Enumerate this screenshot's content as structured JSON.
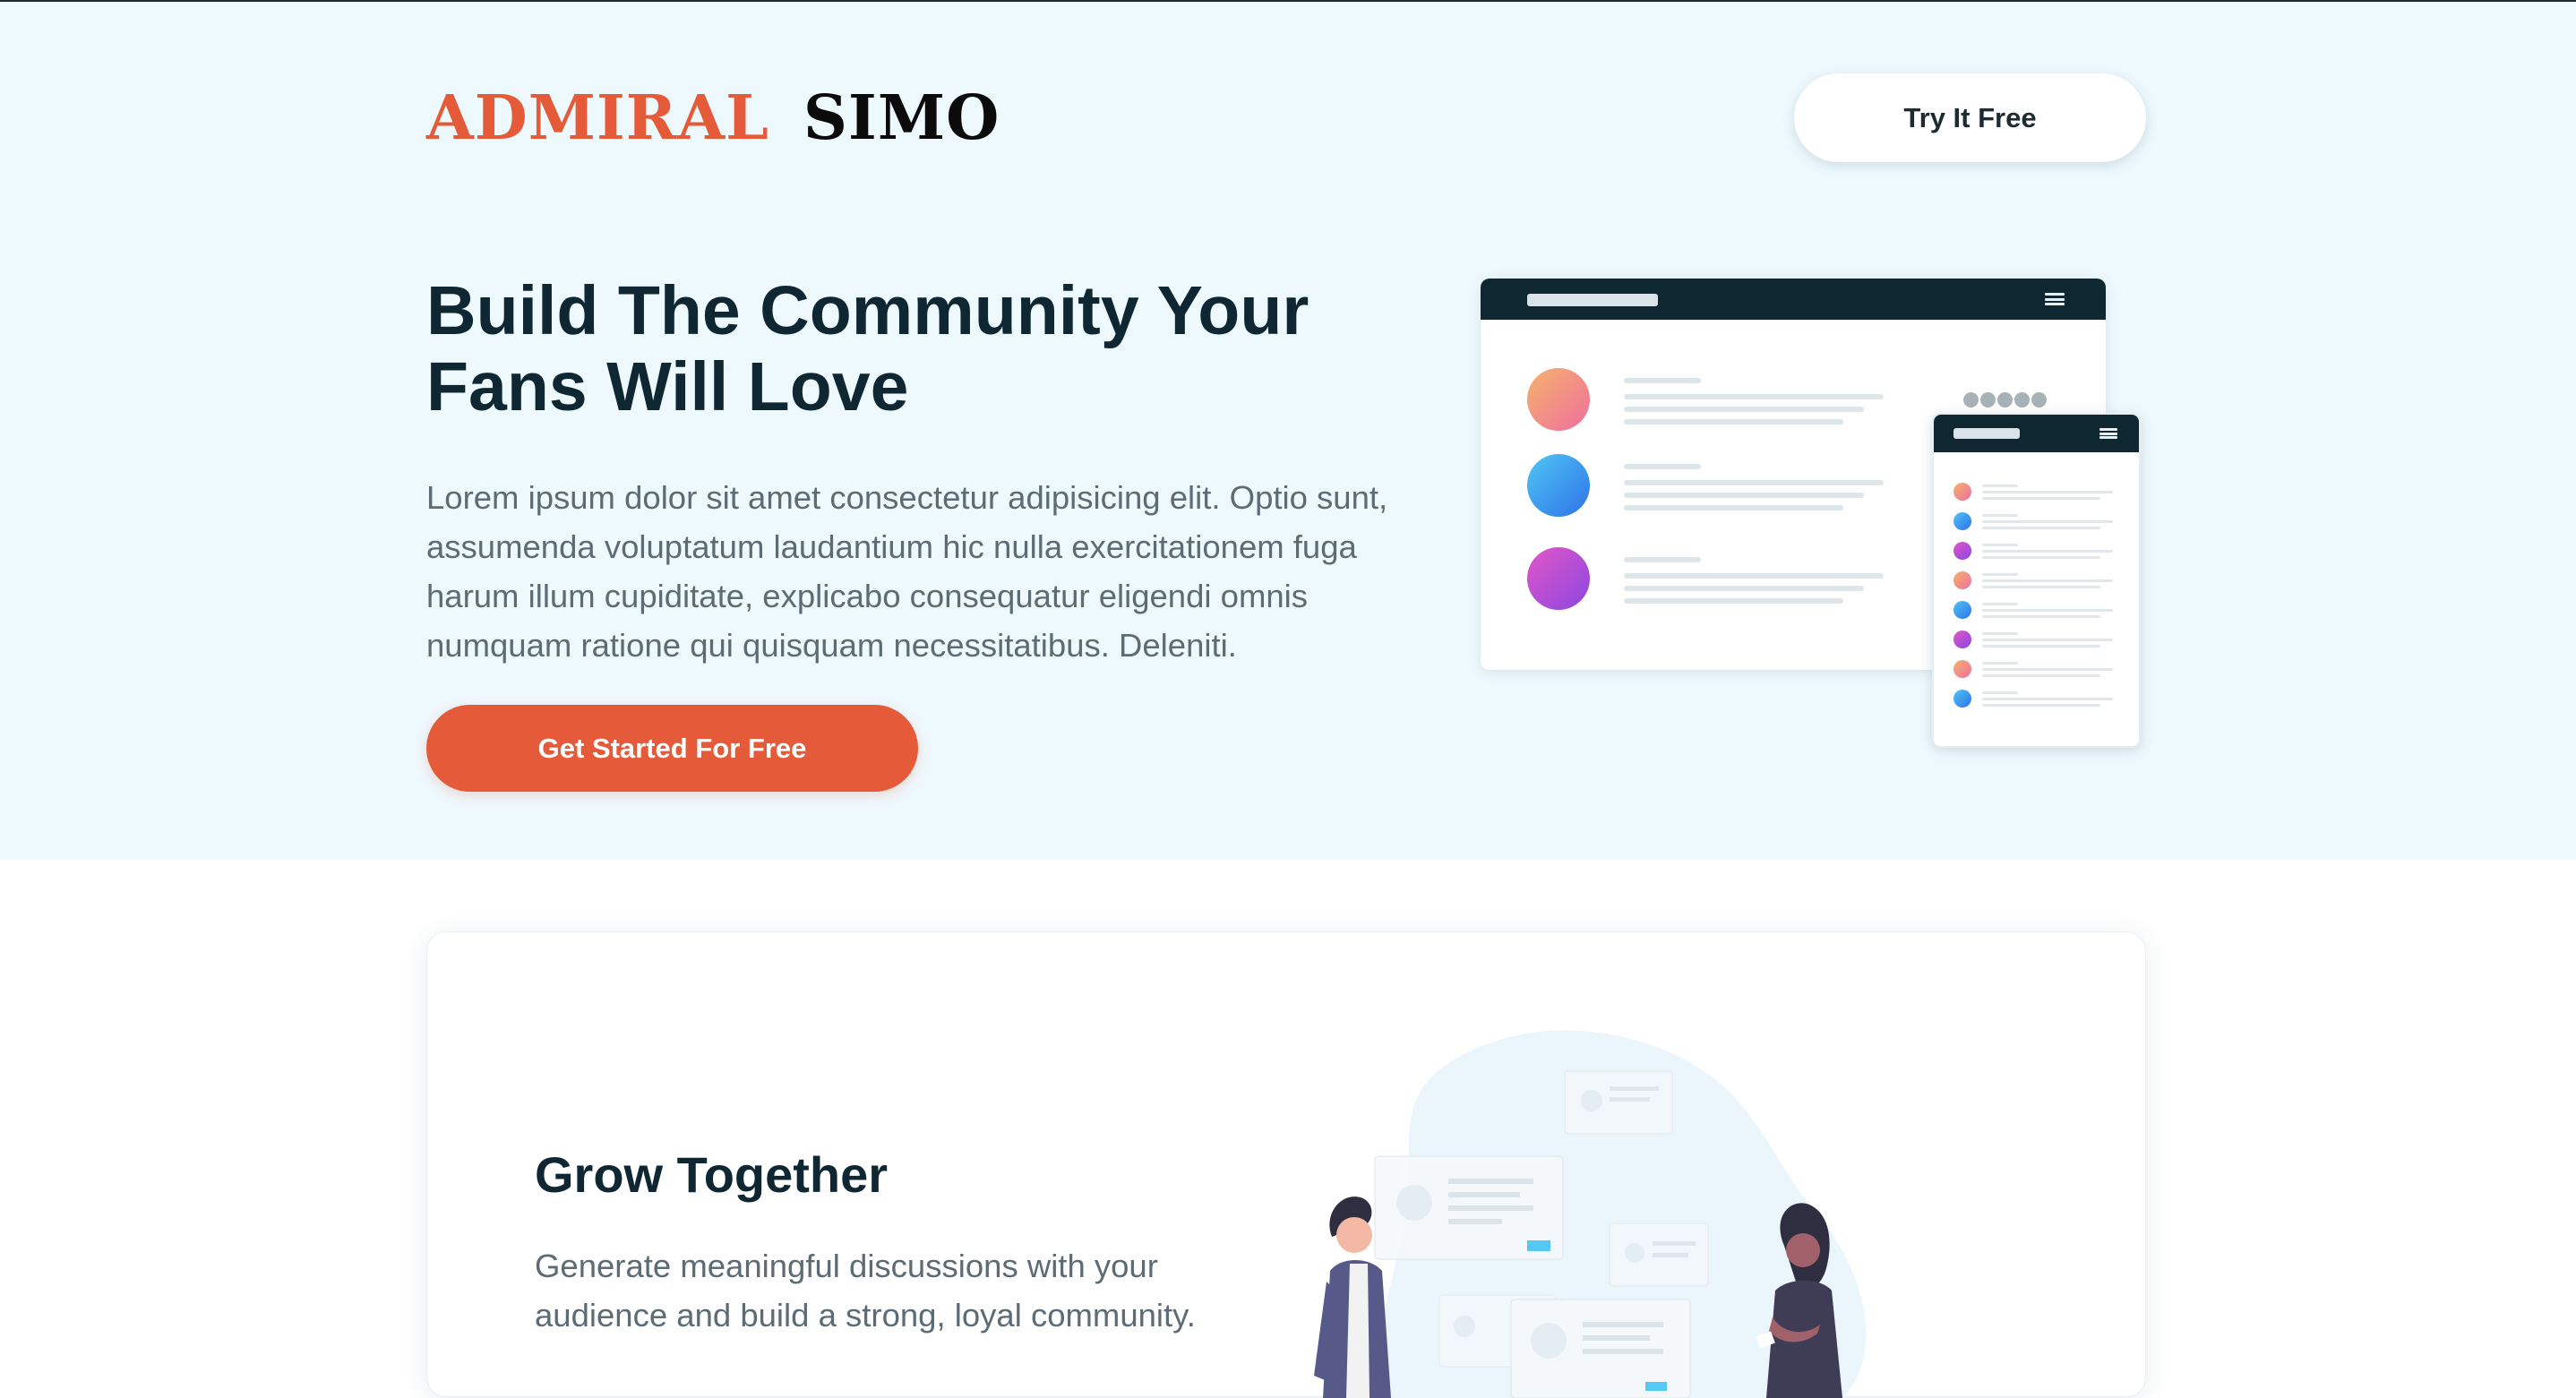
{
  "header": {
    "logo_word_1": "ADMIRAL",
    "logo_word_2": "SIMO",
    "try_button_label": "Try It Free"
  },
  "hero": {
    "title_line_1": "Build The Community Your",
    "title_line_2": "Fans Will Love",
    "paragraph": "Lorem ipsum dolor sit amet consectetur adipisicing elit. Optio sunt, assumenda voluptatum laudantium hic nulla exercitationem fuga harum illum cupiditate, explicabo consequatur eligendi omnis numquam ratione qui quisquam necessitatibus. Deleniti.",
    "cta_label": "Get Started For Free"
  },
  "features": {
    "title": "Grow Together",
    "paragraph": "Generate meaningful discussions with your audience and build a strong, loyal community."
  },
  "colors": {
    "brand_orange": "#e55a39",
    "navy": "#0e2732",
    "hero_background": "#eef9fd",
    "text_gray": "#5c6b74"
  },
  "icons": {
    "mockup_menu": "hamburger-menu-icon"
  }
}
